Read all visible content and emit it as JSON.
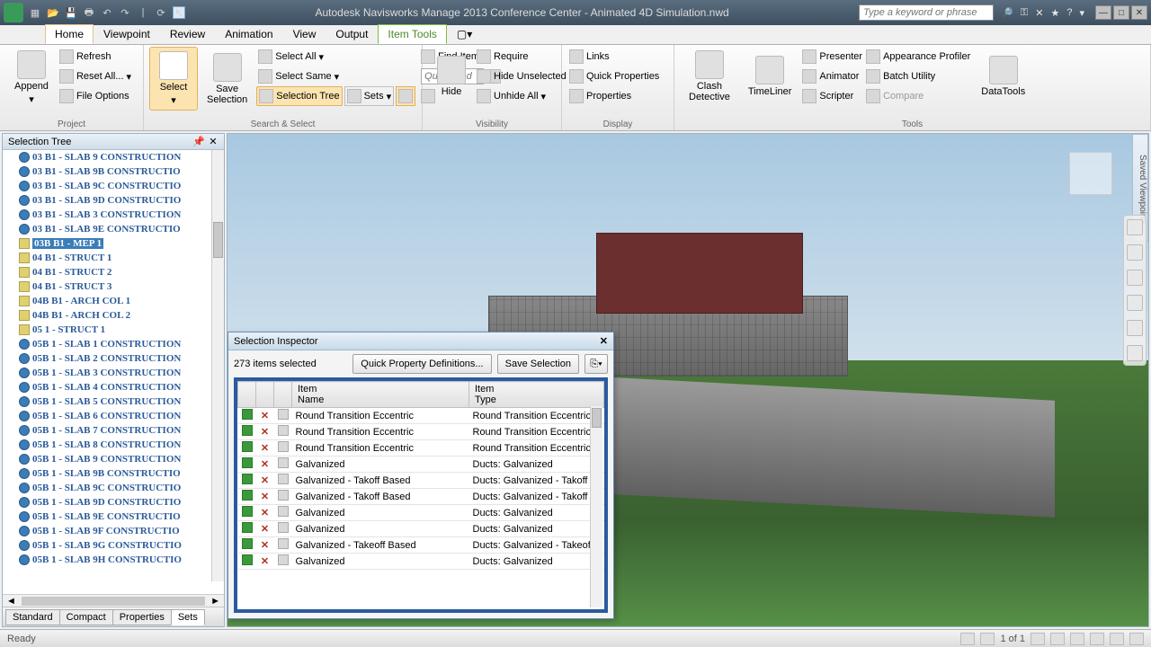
{
  "title": "Autodesk Navisworks Manage 2013    Conference Center - Animated 4D Simulation.nwd",
  "searchPlaceholder": "Type a keyword or phrase",
  "tabs": [
    "Home",
    "Viewpoint",
    "Review",
    "Animation",
    "View",
    "Output",
    "Item Tools"
  ],
  "ribbon": {
    "append": "Append",
    "refresh": "Refresh",
    "resetAll": "Reset All...",
    "fileOptions": "File Options",
    "project": "Project",
    "select": "Select",
    "saveSelection": "Save\nSelection",
    "selectAll": "Select All",
    "selectSame": "Select Same",
    "selectionTree": "Selection Tree",
    "sets": "Sets",
    "findItems": "Find Items",
    "quickFindPh": "Quick Find",
    "searchSelect": "Search & Select",
    "hide": "Hide",
    "require": "Require",
    "hideUnselected": "Hide Unselected",
    "unhideAll": "Unhide All",
    "visibility": "Visibility",
    "links": "Links",
    "quickProps": "Quick Properties",
    "properties": "Properties",
    "display": "Display",
    "clash": "Clash\nDetective",
    "timeliner": "TimeLiner",
    "presenter": "Presenter",
    "animator": "Animator",
    "scripter": "Scripter",
    "appProfiler": "Appearance Profiler",
    "batchUtility": "Batch Utility",
    "compare": "Compare",
    "tools": "Tools",
    "dataTools": "DataTools"
  },
  "treePanel": {
    "title": "Selection Tree",
    "items": [
      {
        "t": "03 B1 - SLAB 9 CONSTRUCTION",
        "sel": false
      },
      {
        "t": "03 B1 - SLAB 9B CONSTRUCTIO",
        "sel": false
      },
      {
        "t": "03 B1 - SLAB 9C CONSTRUCTIO",
        "sel": false
      },
      {
        "t": "03 B1 - SLAB 9D CONSTRUCTIO",
        "sel": false
      },
      {
        "t": "03 B1 - SLAB 3 CONSTRUCTION",
        "sel": false
      },
      {
        "t": "03 B1 - SLAB 9E CONSTRUCTIO",
        "sel": false
      },
      {
        "t": "03B B1 - MEP 1",
        "sel": true,
        "file": true
      },
      {
        "t": "04 B1 - STRUCT 1",
        "sel": false,
        "file": true
      },
      {
        "t": "04 B1 - STRUCT 2",
        "sel": false,
        "file": true
      },
      {
        "t": "04 B1 - STRUCT 3",
        "sel": false,
        "file": true
      },
      {
        "t": "04B B1 - ARCH COL 1",
        "sel": false,
        "file": true
      },
      {
        "t": "04B B1 - ARCH COL 2",
        "sel": false,
        "file": true
      },
      {
        "t": "05 1 - STRUCT 1",
        "sel": false,
        "file": true
      },
      {
        "t": "05B 1 - SLAB 1 CONSTRUCTION",
        "sel": false
      },
      {
        "t": "05B 1 - SLAB 2 CONSTRUCTION",
        "sel": false
      },
      {
        "t": "05B 1 - SLAB 3 CONSTRUCTION",
        "sel": false
      },
      {
        "t": "05B 1 - SLAB 4 CONSTRUCTION",
        "sel": false
      },
      {
        "t": "05B 1 - SLAB 5 CONSTRUCTION",
        "sel": false
      },
      {
        "t": "05B 1 - SLAB 6 CONSTRUCTION",
        "sel": false
      },
      {
        "t": "05B 1 - SLAB 7 CONSTRUCTION",
        "sel": false
      },
      {
        "t": "05B 1 - SLAB 8 CONSTRUCTION",
        "sel": false
      },
      {
        "t": "05B 1 - SLAB 9 CONSTRUCTION",
        "sel": false
      },
      {
        "t": "05B 1 - SLAB 9B CONSTRUCTIO",
        "sel": false
      },
      {
        "t": "05B 1 - SLAB 9C CONSTRUCTIO",
        "sel": false
      },
      {
        "t": "05B 1 - SLAB 9D CONSTRUCTIO",
        "sel": false
      },
      {
        "t": "05B 1 - SLAB 9E CONSTRUCTIO",
        "sel": false
      },
      {
        "t": "05B 1 - SLAB 9F CONSTRUCTIO",
        "sel": false
      },
      {
        "t": "05B 1 - SLAB 9G CONSTRUCTIO",
        "sel": false
      },
      {
        "t": "05B 1 - SLAB 9H CONSTRUCTIO",
        "sel": false
      }
    ],
    "tabs": [
      "Standard",
      "Compact",
      "Properties",
      "Sets"
    ],
    "activeTab": 3
  },
  "inspector": {
    "title": "Selection Inspector",
    "status": "273 items selected",
    "btnQuick": "Quick Property Definitions...",
    "btnSave": "Save Selection",
    "col1": "Item\nName",
    "col2": "Item\nType",
    "rows": [
      {
        "n": "Round Transition Eccentric",
        "t": "Round Transition Eccentric:"
      },
      {
        "n": "Round Transition Eccentric",
        "t": "Round Transition Eccentric:"
      },
      {
        "n": "Round Transition Eccentric",
        "t": "Round Transition Eccentric:"
      },
      {
        "n": "Galvanized",
        "t": "Ducts: Galvanized"
      },
      {
        "n": "Galvanized - Takoff Based",
        "t": "Ducts: Galvanized - Takoff B"
      },
      {
        "n": "Galvanized - Takoff Based",
        "t": "Ducts: Galvanized - Takoff B"
      },
      {
        "n": "Galvanized",
        "t": "Ducts: Galvanized"
      },
      {
        "n": "Galvanized",
        "t": "Ducts: Galvanized"
      },
      {
        "n": "Galvanized - Takeoff Based",
        "t": "Ducts: Galvanized - Takeoff"
      },
      {
        "n": "Galvanized",
        "t": "Ducts: Galvanized"
      }
    ]
  },
  "savedViewpoints": "Saved Viewpoints",
  "status": {
    "ready": "Ready",
    "page": "1 of 1"
  }
}
